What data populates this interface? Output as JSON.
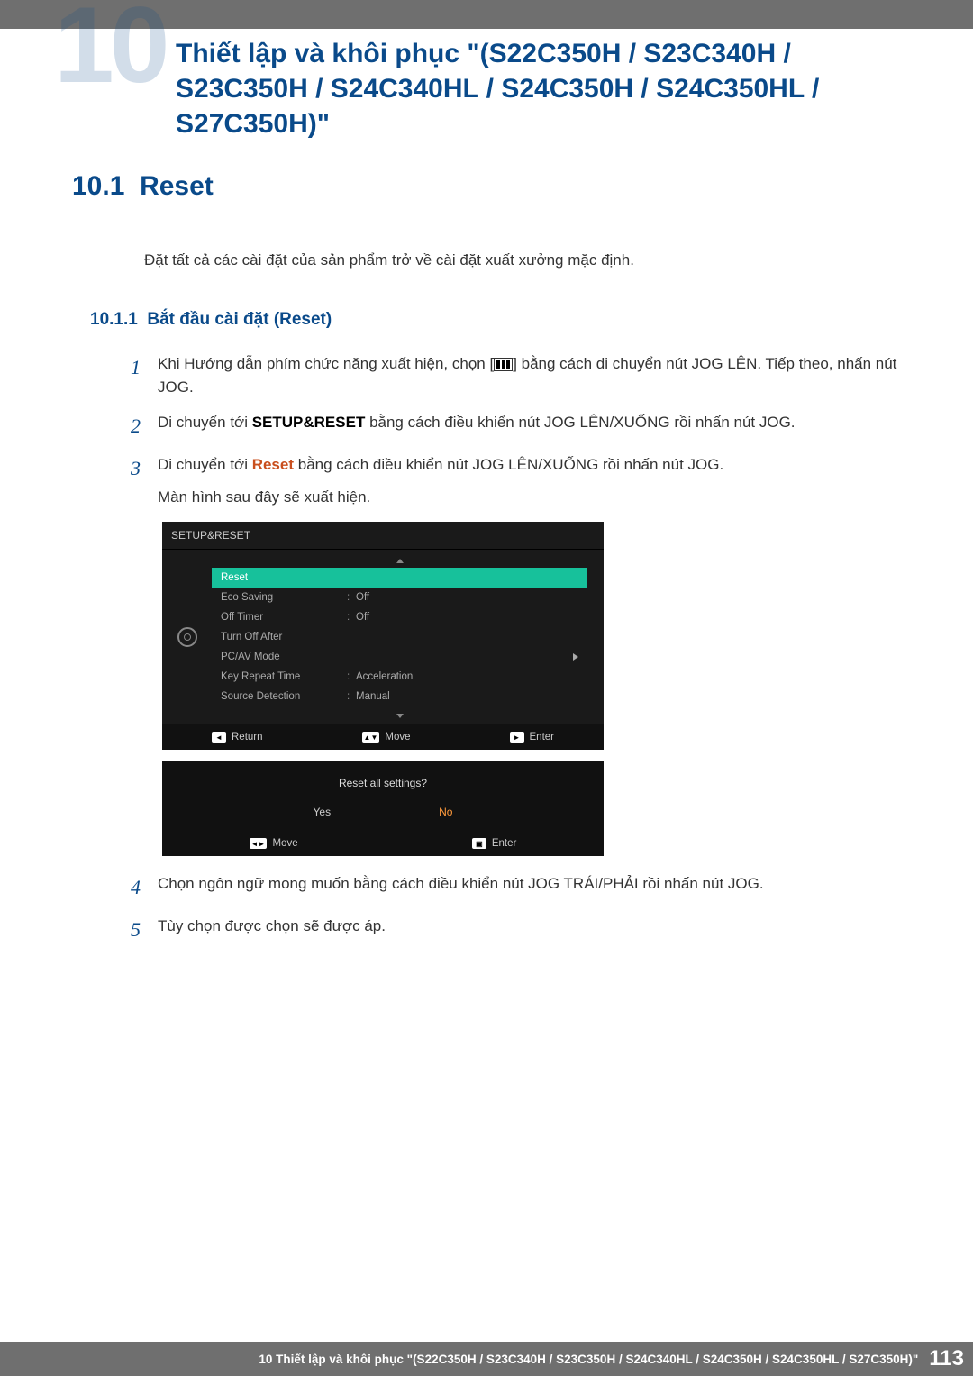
{
  "chapter": {
    "number": "10",
    "title": "Thiết lập và khôi phục \"(S22C350H / S23C340H / S23C350H / S24C340HL / S24C350H / S24C350HL / S27C350H)\""
  },
  "section": {
    "number": "10.1",
    "title": "Reset",
    "description": "Đặt tất cả các cài đặt của sản phẩm trở về cài đặt xuất xưởng mặc định."
  },
  "subsection": {
    "number": "10.1.1",
    "title": "Bắt đầu cài đặt (Reset)"
  },
  "steps": {
    "s1_a": "Khi Hướng dẫn phím chức năng xuất hiện, chọn [",
    "s1_b": "] bằng cách di chuyển nút JOG LÊN. Tiếp theo, nhấn nút JOG.",
    "s2_a": "Di chuyển tới ",
    "s2_bold": "SETUP&RESET",
    "s2_b": " bằng cách điều khiển nút JOG LÊN/XUỐNG rồi nhấn nút JOG.",
    "s3_a": "Di chuyển tới ",
    "s3_bold": "Reset",
    "s3_b": " bằng cách điều khiển nút JOG LÊN/XUỐNG rồi nhấn nút JOG.",
    "s3_note": "Màn hình sau đây sẽ xuất hiện.",
    "s4": "Chọn ngôn ngữ mong muốn bằng cách điều khiển nút JOG TRÁI/PHẢI rồi nhấn nút JOG.",
    "s5": "Tùy chọn được chọn sẽ được áp."
  },
  "osd": {
    "header": "SETUP&RESET",
    "rows": [
      {
        "label": "Reset",
        "value": "",
        "selected": true
      },
      {
        "label": "Eco Saving",
        "value": "Off"
      },
      {
        "label": "Off Timer",
        "value": "Off"
      },
      {
        "label": "Turn Off After",
        "value": ""
      },
      {
        "label": "PC/AV Mode",
        "value": "",
        "arrow": true
      },
      {
        "label": "Key Repeat Time",
        "value": "Acceleration"
      },
      {
        "label": "Source Detection",
        "value": "Manual"
      }
    ],
    "footer": {
      "return": "Return",
      "move": "Move",
      "enter": "Enter"
    },
    "confirm": {
      "question": "Reset all settings?",
      "yes": "Yes",
      "no": "No",
      "move": "Move",
      "enter": "Enter"
    }
  },
  "footer": {
    "text": "10 Thiết lập và khôi phục \"(S22C350H / S23C340H / S23C350H / S24C340HL / S24C350H / S24C350HL / S27C350H)\"",
    "page": "113"
  }
}
